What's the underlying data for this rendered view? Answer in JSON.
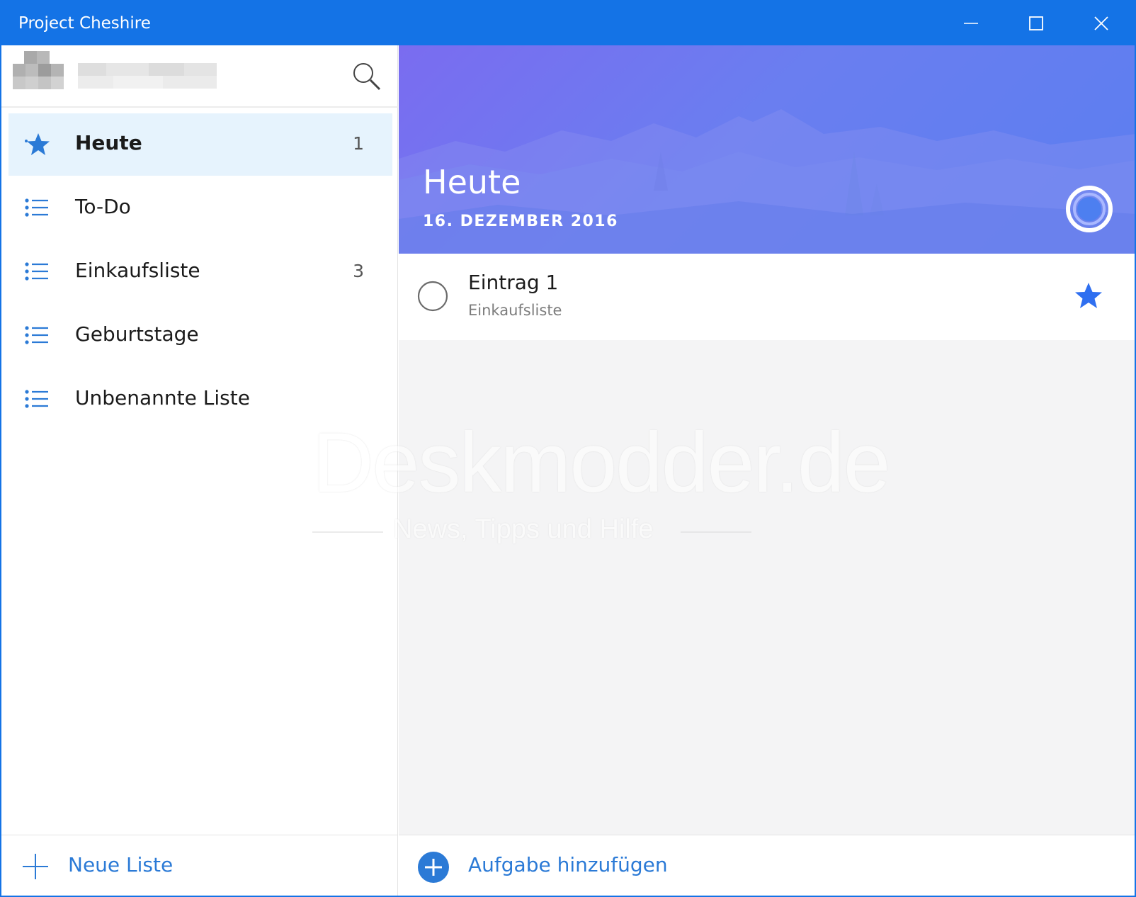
{
  "window": {
    "title": "Project Cheshire",
    "accent_color": "#1473e6"
  },
  "titlebar_buttons": [
    {
      "name": "minimize",
      "icon": "minimize-icon"
    },
    {
      "name": "maximize",
      "icon": "maximize-icon"
    },
    {
      "name": "close",
      "icon": "close-icon"
    }
  ],
  "account": {
    "avatar": "pixelated-avatar",
    "name_redacted": true,
    "search_icon": "search-icon"
  },
  "sidebar": {
    "items": [
      {
        "label": "Heute",
        "count": "1",
        "icon": "star-icon",
        "active": true
      },
      {
        "label": "To-Do",
        "count": "",
        "icon": "list-icon",
        "active": false
      },
      {
        "label": "Einkaufsliste",
        "count": "3",
        "icon": "list-icon",
        "active": false
      },
      {
        "label": "Geburtstage",
        "count": "",
        "icon": "list-icon",
        "active": false
      },
      {
        "label": "Unbenannte Liste",
        "count": "",
        "icon": "list-icon",
        "active": false
      }
    ],
    "new_list_label": "Neue Liste"
  },
  "main": {
    "heading": "Heute",
    "date": "16. DEZEMBER 2016",
    "tasks": [
      {
        "title": "Eintrag 1",
        "list": "Einkaufsliste",
        "starred": true
      }
    ],
    "add_task_label": "Aufgabe hinzufügen",
    "star_color": "#2f6ff0"
  },
  "watermark": {
    "title": "Deskmodder.de",
    "subtitle": "News, Tipps und Hilfe"
  }
}
